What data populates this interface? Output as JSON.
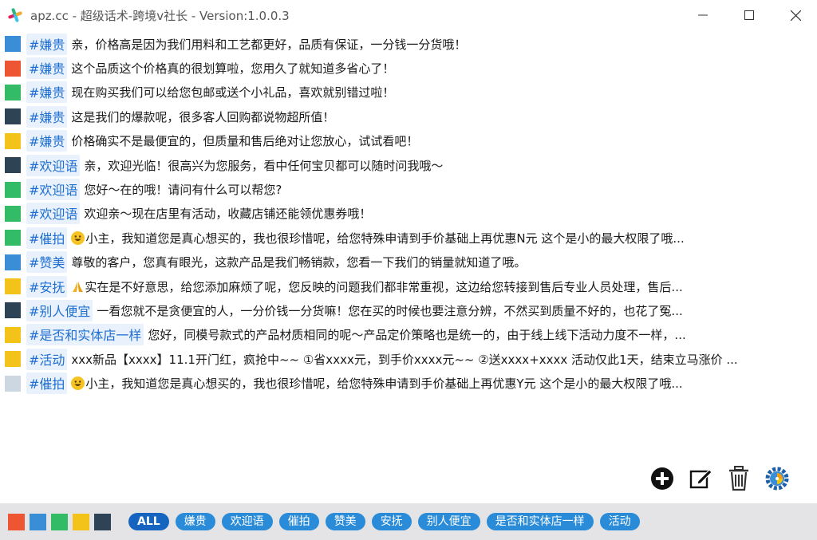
{
  "window": {
    "title": "apz.cc - 超级话术-跨境v社长 - Version:1.0.0.3"
  },
  "colors": {
    "red": "#ee5533",
    "blue": "#3a8ed6",
    "green": "#33bb66",
    "yellow": "#f3c31a",
    "navy": "#2f4356",
    "gray": "#cdd7e1",
    "tag_text": "#1f6fd1",
    "chip_bg": "#2a8bd8"
  },
  "rows": [
    {
      "color": "#3a8ed6",
      "tag": "#嫌贵",
      "emoji": false,
      "text": "亲，价格高是因为我们用料和工艺都更好，品质有保证，一分钱一分货哦！"
    },
    {
      "color": "#ee5533",
      "tag": "#嫌贵",
      "emoji": false,
      "text": "这个品质这个价格真的很划算啦，您用久了就知道多省心了！"
    },
    {
      "color": "#33bb66",
      "tag": "#嫌贵",
      "emoji": false,
      "text": "现在购买我们可以给您包邮或送个小礼品，喜欢就别错过啦！"
    },
    {
      "color": "#2f4356",
      "tag": "#嫌贵",
      "emoji": false,
      "text": "这是我们的爆款呢，很多客人回购都说物超所值！"
    },
    {
      "color": "#f3c31a",
      "tag": "#嫌贵",
      "emoji": false,
      "text": "价格确实不是最便宜的，但质量和售后绝对让您放心，试试看吧！"
    },
    {
      "color": "#2f4356",
      "tag": "#欢迎语",
      "emoji": false,
      "text": "亲，欢迎光临！很高兴为您服务，看中任何宝贝都可以随时问我哦～"
    },
    {
      "color": "#33bb66",
      "tag": "#欢迎语",
      "emoji": false,
      "text": "您好～在的哦！请问有什么可以帮您?"
    },
    {
      "color": "#33bb66",
      "tag": "#欢迎语",
      "emoji": false,
      "text": "欢迎亲～现在店里有活动，收藏店铺还能领优惠券哦！"
    },
    {
      "color": "#33bb66",
      "tag": "#催拍",
      "emoji": "smile",
      "text": "小主，我知道您是真心想买的，我也很珍惜呢，给您特殊申请到手价基础上再优惠N元 这个是小的最大权限了哦..."
    },
    {
      "color": "#3a8ed6",
      "tag": "#赞美",
      "emoji": false,
      "text": "尊敬的客户，您真有眼光，这款产品是我们畅销款，您看一下我们的销量就知道了哦。"
    },
    {
      "color": "#f3c31a",
      "tag": "#安抚",
      "emoji": "pray",
      "text": "实在是不好意思，给您添加麻烦了呢，您反映的问题我们都非常重视，这边给您转接到售后专业人员处理，售后..."
    },
    {
      "color": "#2f4356",
      "tag": "#别人便宜",
      "emoji": false,
      "text": "一看您就不是贪便宜的人，一分价钱一分货嘛！您在买的时候也要注意分辨，不然买到质量不好的，也花了冤..."
    },
    {
      "color": "#f3c31a",
      "tag": "#是否和实体店一样",
      "emoji": false,
      "text": "您好，同模号款式的产品材质相同的呢～产品定价策略也是统一的，由于线上线下活动力度不一样，..."
    },
    {
      "color": "#f3c31a",
      "tag": "#活动",
      "emoji": false,
      "text": "xxx新品【xxxx】11.1开门红，疯抢中~~ ①省xxxx元，到手价xxxx元~~ ②送xxxx+xxxx 活动仅此1天，结束立马涨价 ..."
    },
    {
      "color": "#cdd7e1",
      "tag": "#催拍",
      "emoji": "smile",
      "text": "小主，我知道您是真心想买的，我也很珍惜呢，给您特殊申请到手价基础上再优惠Y元 这个是小的最大权限了哦..."
    }
  ],
  "tools": [
    {
      "name": "add-icon"
    },
    {
      "name": "edit-icon"
    },
    {
      "name": "trash-icon"
    },
    {
      "name": "settings-icon"
    }
  ],
  "palette": [
    "#ee5533",
    "#3a8ed6",
    "#33bb66",
    "#f3c31a",
    "#2f4356"
  ],
  "filters": [
    {
      "label": "ALL",
      "active": true
    },
    {
      "label": "嫌贵",
      "active": false
    },
    {
      "label": "欢迎语",
      "active": false
    },
    {
      "label": "催拍",
      "active": false
    },
    {
      "label": "赞美",
      "active": false
    },
    {
      "label": "安抚",
      "active": false
    },
    {
      "label": "别人便宜",
      "active": false
    },
    {
      "label": "是否和实体店一样",
      "active": false
    },
    {
      "label": "活动",
      "active": false
    }
  ]
}
